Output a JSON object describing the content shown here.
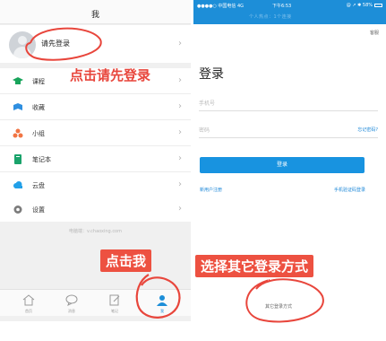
{
  "left": {
    "title": "我",
    "login_prompt": "请先登录",
    "menu": [
      {
        "icon": "graduation-cap-icon",
        "label": "课程",
        "color": "#18a45b"
      },
      {
        "icon": "bookmark-icon",
        "label": "收藏",
        "color": "#2f8fe0"
      },
      {
        "icon": "group-icon",
        "label": "小组",
        "color": "#f17544"
      },
      {
        "icon": "notebook-icon",
        "label": "笔记本",
        "color": "#1aa36b"
      },
      {
        "icon": "cloud-icon",
        "label": "云盘",
        "color": "#22a0e8"
      }
    ],
    "settings_label": "设置",
    "server_line": "电脑端：v.chaoxing.com",
    "tabs": [
      {
        "icon": "home-icon",
        "label": "首页"
      },
      {
        "icon": "message-icon",
        "label": "消息"
      },
      {
        "icon": "note-icon",
        "label": "笔记"
      },
      {
        "icon": "person-icon",
        "label": "我",
        "active": true
      }
    ]
  },
  "right": {
    "status_left": "●●●●○ 中国电信  4G",
    "status_time": "下午6:53",
    "status_right": "@ ↗ ✱ 58%",
    "status_sub": "个人热点：1个连接",
    "service_link": "客服",
    "login_title": "登录",
    "phone_placeholder": "手机号",
    "password_placeholder": "密码",
    "forgot_link": "忘记密码?",
    "login_button": "登录",
    "register_link": "新用户注册",
    "sms_login_link": "手机验证码登录",
    "other_login": "其它登录方式"
  },
  "annotations": {
    "click_login": "点击请先登录",
    "click_me": "点击我",
    "choose_other": "选择其它登录方式",
    "accent": "#e8463c"
  }
}
